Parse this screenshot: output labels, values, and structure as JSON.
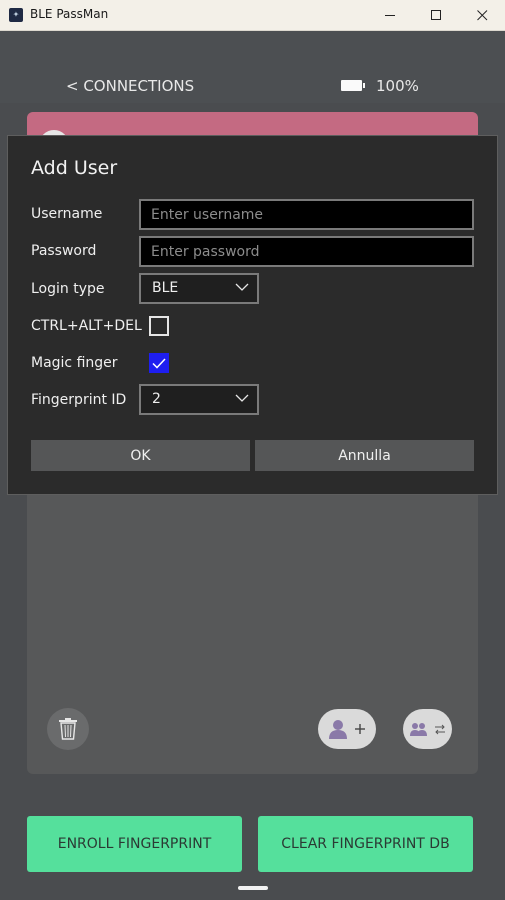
{
  "window": {
    "title": "BLE PassMan",
    "icon": "ble-passman-app-icon"
  },
  "header": {
    "back_label": "< CONNECTIONS",
    "battery_label": "100%",
    "battery_icon": "battery-icon"
  },
  "dialog": {
    "title": "Add User",
    "username_label": "Username",
    "username_placeholder": "Enter username",
    "username_value": "",
    "password_label": "Password",
    "password_placeholder": "Enter password",
    "password_value": "",
    "login_type_label": "Login type",
    "login_type_value": "BLE",
    "ctrl_alt_del_label": "CTRL+ALT+DEL",
    "ctrl_alt_del_checked": false,
    "magic_finger_label": "Magic finger",
    "magic_finger_checked": true,
    "fingerprint_id_label": "Fingerprint ID",
    "fingerprint_id_value": "2",
    "ok_label": "OK",
    "cancel_label": "Annulla"
  },
  "actions": {
    "enroll_label": "ENROLL FINGERPRINT",
    "clear_label": "CLEAR FINGERPRINT DB"
  },
  "colors": {
    "accent_green": "#55e09c",
    "panel_header": "#c46a82",
    "checkbox_checked": "#1e1ef0",
    "dialog_bg": "#2b2b2b"
  }
}
